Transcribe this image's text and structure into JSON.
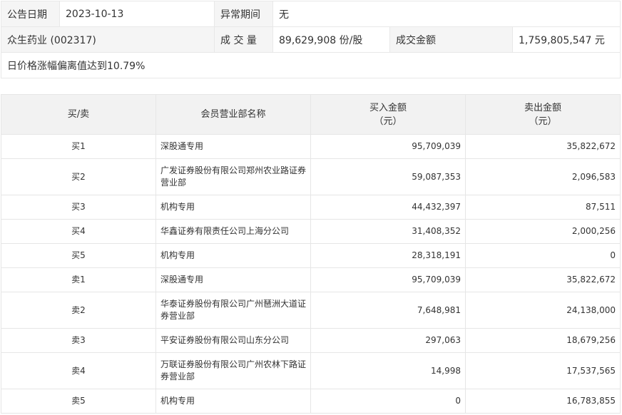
{
  "info": {
    "date_label": "公告日期",
    "date_value": "2023-10-13",
    "abnormal_label": "异常期间",
    "abnormal_value": "无",
    "stock_name": "众生药业 (002317)",
    "volume_label": "成 交 量",
    "volume_value": "89,629,908 份/股",
    "amount_label": "成交金额",
    "amount_value": "1,759,805,547 元",
    "reason": "日价格涨幅偏离值达到10.79%"
  },
  "table": {
    "headers": {
      "side": "买/卖",
      "dept": "会员营业部名称",
      "buy": "买入金额",
      "buy_unit": "（元）",
      "sell": "卖出金额",
      "sell_unit": "（元）"
    },
    "rows": [
      {
        "side": "买1",
        "dept": "深股通专用",
        "buy": "95,709,039",
        "sell": "35,822,672"
      },
      {
        "side": "买2",
        "dept": "广发证券股份有限公司郑州农业路证券营业部",
        "buy": "59,087,353",
        "sell": "2,096,583"
      },
      {
        "side": "买3",
        "dept": "机构专用",
        "buy": "44,432,397",
        "sell": "87,511"
      },
      {
        "side": "买4",
        "dept": "华鑫证券有限责任公司上海分公司",
        "buy": "31,408,352",
        "sell": "2,000,256"
      },
      {
        "side": "买5",
        "dept": "机构专用",
        "buy": "28,318,191",
        "sell": "0"
      },
      {
        "side": "卖1",
        "dept": "深股通专用",
        "buy": "95,709,039",
        "sell": "35,822,672"
      },
      {
        "side": "卖2",
        "dept": "华泰证券股份有限公司广州琶洲大道证券营业部",
        "buy": "7,648,981",
        "sell": "24,138,000"
      },
      {
        "side": "卖3",
        "dept": "平安证券股份有限公司山东分公司",
        "buy": "297,063",
        "sell": "18,679,256"
      },
      {
        "side": "卖4",
        "dept": "万联证券股份有限公司广州农林下路证券营业部",
        "buy": "14,998",
        "sell": "17,537,565"
      },
      {
        "side": "卖5",
        "dept": "机构专用",
        "buy": "0",
        "sell": "16,783,855"
      }
    ]
  }
}
